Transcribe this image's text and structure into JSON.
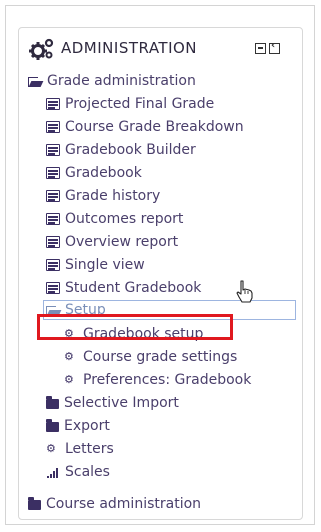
{
  "block": {
    "title": "ADMINISTRATION",
    "icon": "cogs-icon",
    "controls": [
      "minimize-icon",
      "dock-icon"
    ]
  },
  "tree": {
    "grade_admin": "Grade administration",
    "items": [
      {
        "label": "Projected Final Grade",
        "icon": "list-icon"
      },
      {
        "label": "Course Grade Breakdown",
        "icon": "list-icon"
      },
      {
        "label": "Gradebook Builder",
        "icon": "list-icon"
      },
      {
        "label": "Gradebook",
        "icon": "list-icon"
      },
      {
        "label": "Grade history",
        "icon": "list-icon"
      },
      {
        "label": "Outcomes report",
        "icon": "list-icon"
      },
      {
        "label": "Overview report",
        "icon": "list-icon"
      },
      {
        "label": "Single view",
        "icon": "list-icon"
      },
      {
        "label": "Student Gradebook",
        "icon": "list-icon"
      }
    ],
    "setup": {
      "label": "Setup",
      "children": [
        {
          "label": "Gradebook setup",
          "icon": "gear-icon"
        },
        {
          "label": "Course grade settings",
          "icon": "gear-icon"
        },
        {
          "label": "Preferences: Gradebook",
          "icon": "gear-icon"
        }
      ]
    },
    "more": [
      {
        "label": "Selective Import",
        "icon": "folder-icon"
      },
      {
        "label": "Export",
        "icon": "folder-icon"
      },
      {
        "label": "Letters",
        "icon": "gear-icon"
      },
      {
        "label": "Scales",
        "icon": "bars-icon"
      }
    ],
    "course_admin": "Course administration"
  },
  "colors": {
    "text": "#4a3f6b",
    "highlight": "#e0181f",
    "focus_border": "#9db5e0"
  }
}
